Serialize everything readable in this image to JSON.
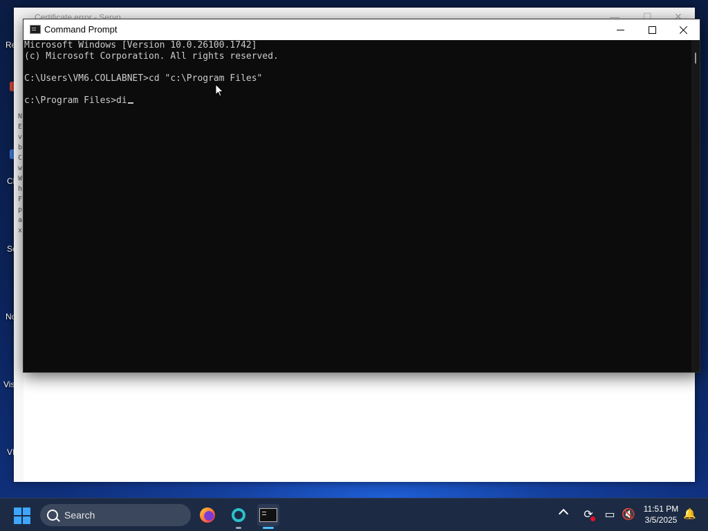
{
  "desktop": {
    "labels": [
      "Re",
      "Cl",
      "Se",
      "No",
      "Vis",
      "VL"
    ]
  },
  "background_window": {
    "title": "Certificate error - Servo",
    "text_lines": [
      "N",
      "E",
      "v",
      "b",
      "C",
      "w",
      "W",
      "h",
      "F",
      "p",
      "a",
      "x"
    ]
  },
  "cmd_window": {
    "title": "Command Prompt",
    "lines": [
      "Microsoft Windows [Version 10.0.26100.1742]",
      "(c) Microsoft Corporation. All rights reserved.",
      "",
      "C:\\Users\\VM6.COLLABNET>cd \"c:\\Program Files\"",
      "",
      "c:\\Program Files>di"
    ],
    "minimize_icon": "minimize-icon",
    "maximize_icon": "maximize-icon",
    "close_icon": "close-icon"
  },
  "taskbar": {
    "search_placeholder": "Search",
    "apps": [
      "firefox",
      "teal-app",
      "command-prompt"
    ],
    "clock_time": "11:51 PM",
    "clock_date": "3/5/2025"
  },
  "colors": {
    "console_bg": "#0c0c0c",
    "console_fg": "#cccccc",
    "taskbar_bg": "#1c2a43",
    "accent": "#4cc2ff"
  }
}
